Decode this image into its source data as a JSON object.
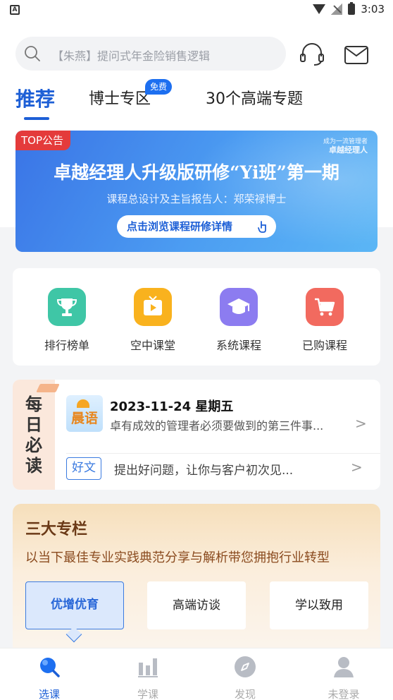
{
  "status_bar": {
    "time": "3:03",
    "left_icon": "A"
  },
  "search": {
    "placeholder": "【朱燕】提问式年金险销售逻辑"
  },
  "tabs": [
    {
      "label": "推荐",
      "active": true
    },
    {
      "label": "博士专区",
      "badge": "免费"
    },
    {
      "label": "30个高端专题"
    }
  ],
  "banner": {
    "tag": "TOP公告",
    "logo_top": "成为一流管理者",
    "logo_bottom": "卓越经理人",
    "title": "卓越经理人升级版研修“Yi班”第一期",
    "subtitle": "课程总设计及主旨报告人：郑荣禄博士",
    "button": "点击浏览课程研修详情",
    "colors": {
      "start": "#3a74e6",
      "end": "#5bb6f5",
      "tag": "#e43b3b"
    }
  },
  "quick_links": [
    {
      "label": "排行榜单",
      "icon": "trophy-icon",
      "color": "#3fc6a6"
    },
    {
      "label": "空中课堂",
      "icon": "tv-play-icon",
      "color": "#f9b21e"
    },
    {
      "label": "系统课程",
      "icon": "graduation-cap-icon",
      "color": "#8c7cf0"
    },
    {
      "label": "已购课程",
      "icon": "cart-icon",
      "color": "#f26a5f"
    }
  ],
  "daily": {
    "side_label": "每日必读",
    "logo_text": "晨语",
    "date": "2023-11-24 星期五",
    "headline": "卓有成效的管理者必须要做到的第三件事...",
    "tag": "好文",
    "article": "提出好问题，让你与客户初次见..."
  },
  "columns": {
    "title": "三大专栏",
    "subtitle": "以当下最佳专业实践典范分享与解析带您拥抱行业转型",
    "items": [
      {
        "label": "优增优育",
        "active": true
      },
      {
        "label": "高端访谈"
      },
      {
        "label": "学以致用"
      }
    ]
  },
  "bottom_nav": [
    {
      "label": "选课",
      "icon": "search-icon",
      "active": true
    },
    {
      "label": "学课",
      "icon": "bar-chart-icon"
    },
    {
      "label": "发现",
      "icon": "compass-icon"
    },
    {
      "label": "未登录",
      "icon": "user-icon"
    }
  ],
  "accent": "#1d5fd6"
}
